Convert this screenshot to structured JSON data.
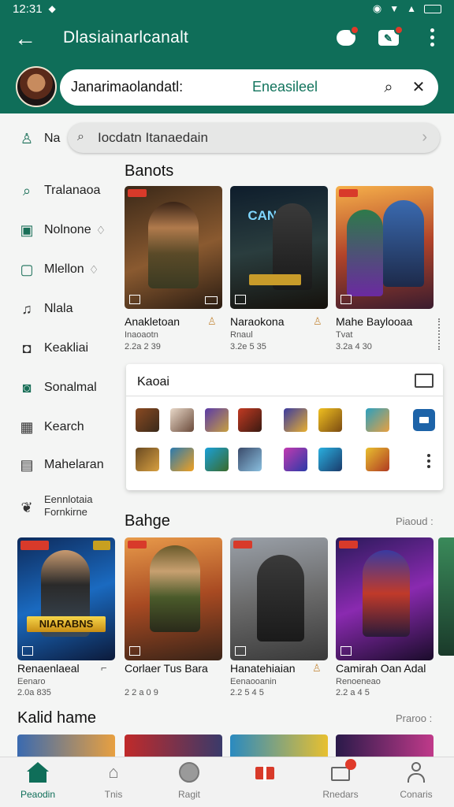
{
  "status": {
    "time": "12:31"
  },
  "header": {
    "title": "Dlasiainarlcanalt",
    "profile_name": "Janarimaolandatl:",
    "profile_link": "Eneasileel"
  },
  "search": {
    "text": "Iocdatn Itanaedain"
  },
  "sidebar": {
    "partial": "Na",
    "items": [
      {
        "label": "Tralanaoa",
        "icon": "search-icon"
      },
      {
        "label": "Nolnone",
        "icon": "square-icon"
      },
      {
        "label": "Mlellon",
        "icon": "folder-icon"
      },
      {
        "label": "Nlala",
        "icon": "bell-icon"
      },
      {
        "label": "Keakliai",
        "icon": "circle-icon"
      },
      {
        "label": "Sonalmal",
        "icon": "camera-icon"
      },
      {
        "label": "Kearch",
        "icon": "grid-icon"
      },
      {
        "label": "Mahelaran",
        "icon": "box-icon"
      }
    ],
    "extra_line1": "Eennlotaia",
    "extra_line2": "Fornkirne"
  },
  "section1": {
    "title": "Banots",
    "cards": [
      {
        "title": "Anakletoan",
        "sub1": "Inaoaotn",
        "sub2": "2.2a 2 39"
      },
      {
        "title": "Naraokona",
        "sub1": "Rnaul",
        "sub2": "3.2e 5 35",
        "logo": "CANDNIG"
      },
      {
        "title": "Mahe Baylooaa",
        "sub1": "Tvat",
        "sub2": "3.2a 4 30"
      }
    ]
  },
  "panel": {
    "title": "Kaoai"
  },
  "section2": {
    "title": "Bahge",
    "more": "Piaoud :",
    "cards": [
      {
        "title": "Renaenlaeal",
        "sub1": "Eenaro",
        "sub2": "2.0a 835",
        "logo": "NIARABNS"
      },
      {
        "title": "Corlaer Tus Bara",
        "sub1": "2 2 a 0 9",
        "sub2": ""
      },
      {
        "title": "Hanatehiaian",
        "sub1": "Eenaooanin",
        "sub2": "2.2 5 4 5"
      },
      {
        "title": "Camirah Oan Adal",
        "sub1": "Renoeneao",
        "sub2": "2.2 a 4 5"
      }
    ]
  },
  "section3": {
    "title": "Kalid hame",
    "more": "Praroo :"
  },
  "nav": [
    {
      "label": "Peaodin",
      "icon": "home-icon"
    },
    {
      "label": "Tnis",
      "icon": "mortarboard-icon"
    },
    {
      "label": "Ragit",
      "icon": "disc-icon"
    },
    {
      "label": "",
      "icon": "gift-icon"
    },
    {
      "label": "Rnedars",
      "icon": "mail-icon"
    },
    {
      "label": "Conaris",
      "icon": "person-icon"
    }
  ]
}
